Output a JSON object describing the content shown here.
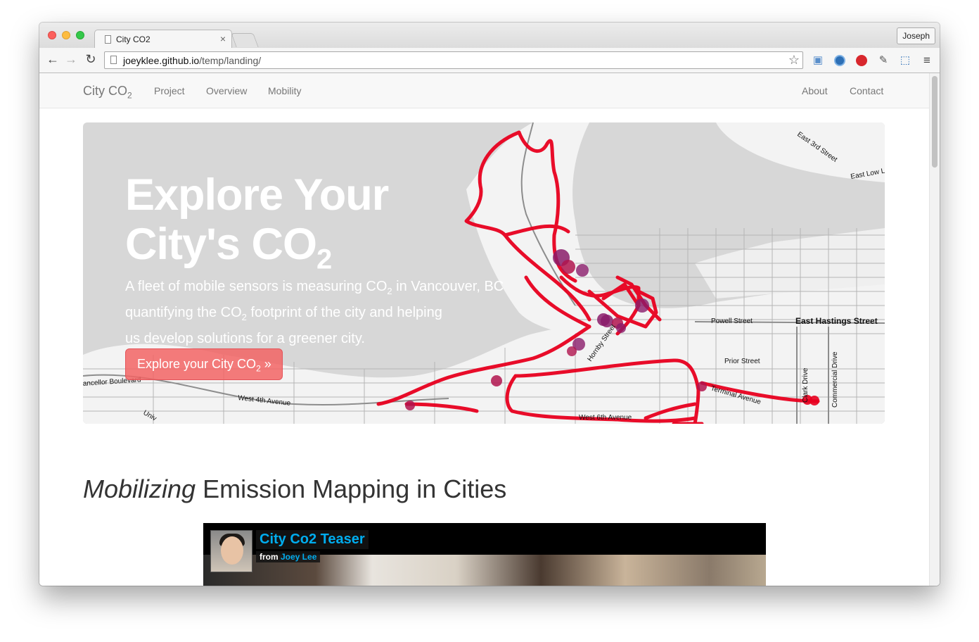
{
  "browser": {
    "tab_title": "City CO2",
    "tab_close": "×",
    "profile_name": "Joseph",
    "url_host": "joeyklee.github.io",
    "url_path": "/temp/landing/",
    "back_glyph": "←",
    "forward_glyph": "→",
    "reload_glyph": "↻",
    "star_glyph": "☆"
  },
  "site_nav": {
    "brand": "City CO",
    "brand_sub": "2",
    "links": [
      "Project",
      "Overview",
      "Mobility"
    ],
    "right_links": [
      "About",
      "Contact"
    ]
  },
  "hero": {
    "title_line1": "Explore Your",
    "title_line2": "City's CO",
    "title_sub": "2",
    "text_1": "A fleet of mobile sensors is measuring CO",
    "text_1_sub": "2",
    "text_1_end": " in Vancouver, BC",
    "text_2": "quantifying the CO",
    "text_2_sub": "2",
    "text_2_end": " footprint of the city and helping",
    "text_3": "us develop solutions for a greener city.",
    "button_label": "Explore your City CO",
    "button_sub": "2",
    "button_end": " »",
    "map_labels": [
      "East 3rd Street",
      "East Low L",
      "Powell Street",
      "East Hastings Street",
      "Prior Street",
      "Terminal Avenue",
      "Clark Drive",
      "Commercial Drive",
      "West 4th Avenue",
      "West 6th Avenue",
      "ancellor Boulevard",
      "Univ",
      "Hornby Street"
    ]
  },
  "section": {
    "title_em": "Mobilizing",
    "title_rest": " Emission Mapping in Cities"
  },
  "video": {
    "title": "City Co2 Teaser",
    "from_label": "from ",
    "author": "Joey Lee"
  },
  "colors": {
    "route": "#e8001f",
    "hotspot": "#8a1c6a",
    "map_bg": "#d7d7d7"
  },
  "icons": [
    "document-icon",
    "bookmark-star-icon",
    "hamburger-menu-icon",
    "extension-icons"
  ]
}
